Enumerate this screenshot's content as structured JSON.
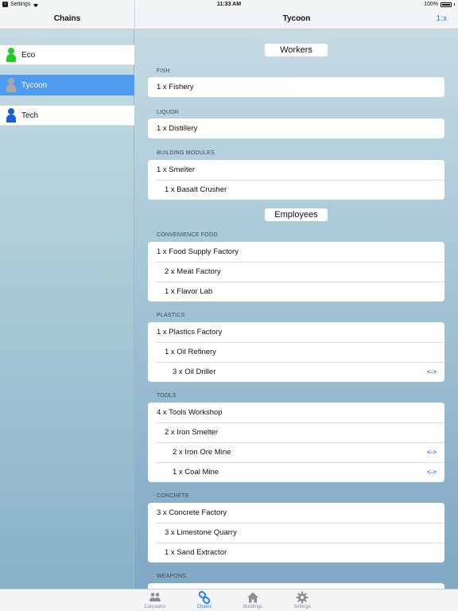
{
  "status_bar": {
    "back_app": "Settings",
    "time": "11:33 AM",
    "battery": "100%"
  },
  "sidebar": {
    "title": "Chains",
    "items": [
      {
        "label": "Eco",
        "color": "#22cc22"
      },
      {
        "label": "Tycoon",
        "color": "#a8a8a8",
        "selected": true
      },
      {
        "label": "Tech",
        "color": "#1a5fd6"
      }
    ]
  },
  "header": {
    "title": "Tycoon",
    "ratio_label": "1:x"
  },
  "groups": {
    "workers": "Workers",
    "employees": "Employees"
  },
  "sections": {
    "fish": {
      "label": "FISH",
      "rows": [
        "1 x Fishery"
      ]
    },
    "liquor": {
      "label": "LIQUOR",
      "rows": [
        "1 x Distillery"
      ]
    },
    "building_modules": {
      "label": "BUILDING MODULES",
      "rows": [
        "1 x Smelter",
        "1 x Basalt Crusher"
      ]
    },
    "convenience_food": {
      "label": "CONVENIENCE FOOD",
      "rows": [
        "1 x Food Supply Factory",
        "2 x Meat Factory",
        "1 x Flavor Lab"
      ]
    },
    "plastics": {
      "label": "PLASTICS",
      "rows": [
        "1 x Plastics Factory",
        "1 x Oil Refinery",
        "3 x Oil Driller"
      ]
    },
    "tools": {
      "label": "TOOLS",
      "rows": [
        "4 x Tools Workshop",
        "2 x Iron Smelter",
        "2 x Iron Ore Mine",
        "1 x Coal Mine"
      ]
    },
    "concrete": {
      "label": "CONCRETE",
      "rows": [
        "3 x Concrete Factory",
        "3 x Limestone Quarry",
        "1 x Sand Extractor"
      ]
    },
    "weapons": {
      "label": "WEAPONS"
    }
  },
  "swap_label": "<->",
  "tab_bar": {
    "tabs": [
      {
        "label": "Calculator",
        "icon": "people-icon"
      },
      {
        "label": "Chains",
        "icon": "chain-link-icon",
        "active": true
      },
      {
        "label": "Buildings",
        "icon": "house-icon"
      },
      {
        "label": "Settings",
        "icon": "gear-icon"
      }
    ]
  },
  "colors": {
    "accent": "#2d7cf6",
    "selected_row": "#4f9bf0"
  }
}
